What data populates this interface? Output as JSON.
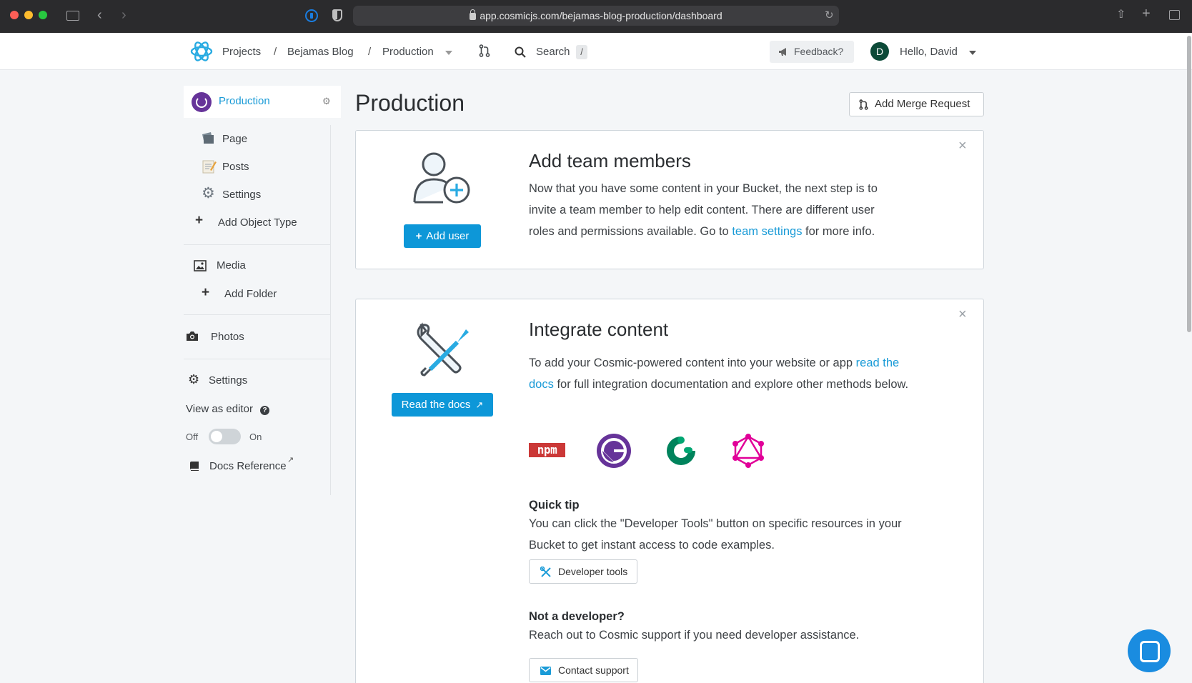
{
  "browser": {
    "url": "app.cosmicjs.com/bejamas-blog-production/dashboard"
  },
  "nav": {
    "breadcrumb": [
      "Projects",
      "Bejamas Blog",
      "Production"
    ],
    "separator": "/",
    "search_label": "Search",
    "search_shortcut": "/",
    "feedback_label": "Feedback?",
    "avatar_initial": "D",
    "user_greeting": "Hello, David"
  },
  "sidebar": {
    "bucket_name": "Production",
    "object_types": [
      {
        "label": "Page",
        "icon": "folder-icon"
      },
      {
        "label": "Posts",
        "icon": "memo-icon"
      },
      {
        "label": "Settings",
        "icon": "gear-icon"
      }
    ],
    "add_object_type": "Add Object Type",
    "media": "Media",
    "add_folder": "Add Folder",
    "photos": "Photos",
    "settings": "Settings",
    "view_as_editor": "View as editor",
    "toggle_off": "Off",
    "toggle_on": "On",
    "docs_reference": "Docs Reference"
  },
  "main": {
    "title": "Production",
    "merge_button": "Add Merge Request",
    "team_card": {
      "title": "Add team members",
      "text_before_link": "Now that you have some content in your Bucket, the next step is to invite a team member to help edit content. There are different user roles and permissions available. Go to ",
      "link": "team settings",
      "text_after_link": " for more info.",
      "button": "Add user"
    },
    "integrate_card": {
      "title": "Integrate content",
      "text_before_link": "To add your Cosmic-powered content into your website or app ",
      "link": "read the docs",
      "text_after_link": " for full integration documentation and explore other methods below.",
      "button": "Read the docs",
      "integrations": [
        "npm",
        "gatsby",
        "gridsome",
        "graphql"
      ],
      "npm_text": "npm",
      "quick_tip_title": "Quick tip",
      "quick_tip_text": "You can click the \"Developer Tools\" button on specific resources in your Bucket to get instant access to code examples.",
      "dev_tools_button": "Developer tools",
      "not_dev_title": "Not a developer?",
      "not_dev_text": "Reach out to Cosmic support if you need developer assistance.",
      "support_button": "Contact support"
    }
  },
  "colors": {
    "accent": "#1a9bd7",
    "primary_button": "#0d97d8",
    "gatsby": "#663399",
    "gridsome": "#00835c",
    "graphql": "#e10098",
    "npm": "#cb3837"
  }
}
